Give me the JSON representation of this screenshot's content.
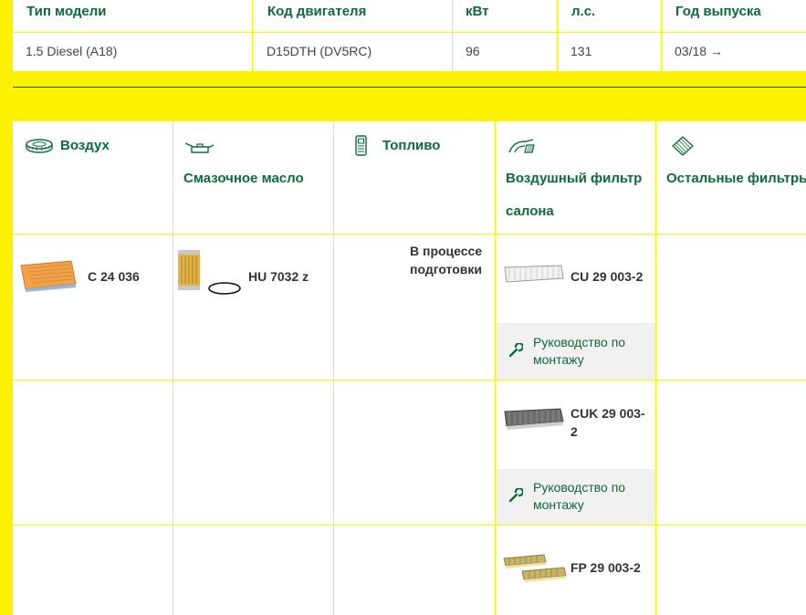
{
  "spec_table": {
    "headers": [
      "Тип модели",
      "Код двигателя",
      "кВт",
      "л.с.",
      "Год выпуска"
    ],
    "row": [
      "1.5 Diesel (A18)",
      "D15DTH (DV5RC)",
      "96",
      "131",
      "03/18 →"
    ]
  },
  "categories": {
    "air": "Воздух",
    "oil": "Смазочное масло",
    "fuel": "Топливо",
    "cabin_line1": "Воздушный фильтр",
    "cabin_line2": "салона",
    "other": "Остальные фильтры"
  },
  "row1": {
    "air_part": "C 24 036",
    "oil_part": "HU 7032 z",
    "fuel_status_line1": "В процессе",
    "fuel_status_line2": "подготовки",
    "cabin_part": "CU 29 003-2",
    "guide_line1": "Руководство по",
    "guide_line2": "монтажу"
  },
  "row2": {
    "cabin_part_line1": "CUK 29 003-",
    "cabin_part_line2": "2",
    "guide_line1": "Руководство по",
    "guide_line2": "монтажу"
  },
  "row3": {
    "cabin_part": "FP 29 003-2"
  },
  "colors": {
    "brand_yellow": "#fff200",
    "brand_green": "#0b6b3a"
  }
}
